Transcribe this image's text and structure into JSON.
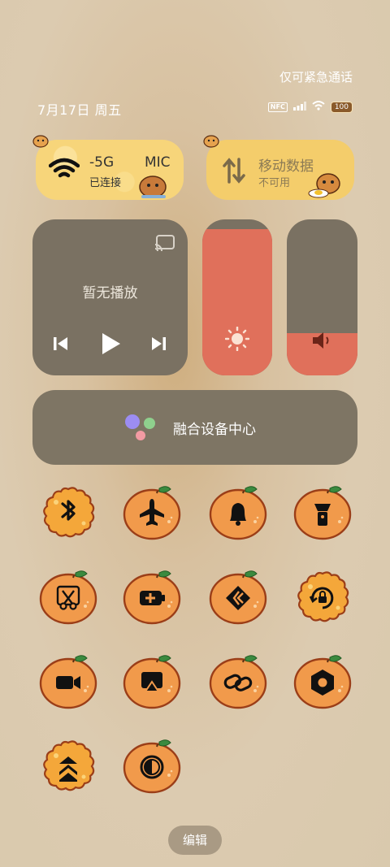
{
  "status_bar": {
    "emergency_text": "仅可紧急通话",
    "date_text": "7月17日 周五",
    "nfc_label": "NFC",
    "battery_level": "100"
  },
  "top_tiles": {
    "wifi": {
      "name": "-5G",
      "extra": "MIC",
      "status": "已连接"
    },
    "mobile_data": {
      "name": "移动数据",
      "status": "不可用"
    }
  },
  "media": {
    "status_text": "暂无播放"
  },
  "sliders": {
    "brightness_level": 0.94,
    "volume_level": 0.27
  },
  "fusion": {
    "label": "融合设备中心"
  },
  "toggles": [
    {
      "name": "bluetooth",
      "icon": "bluetooth-icon",
      "active": true
    },
    {
      "name": "airplane",
      "icon": "airplane-icon",
      "active": false
    },
    {
      "name": "ring",
      "icon": "bell-icon",
      "active": false
    },
    {
      "name": "flashlight",
      "icon": "flashlight-icon",
      "active": false
    },
    {
      "name": "screenshot",
      "icon": "scissors-icon",
      "active": false
    },
    {
      "name": "battery-saver",
      "icon": "battery-plus-icon",
      "active": false
    },
    {
      "name": "nfc",
      "icon": "nfc-icon",
      "active": false
    },
    {
      "name": "rotation-lock",
      "icon": "rotation-lock-icon",
      "active": true
    },
    {
      "name": "screen-record",
      "icon": "video-camera-icon",
      "active": false
    },
    {
      "name": "screen-cast",
      "icon": "cast-icon",
      "active": false
    },
    {
      "name": "link",
      "icon": "link-icon",
      "active": false
    },
    {
      "name": "settings",
      "icon": "hexagon-nut-icon",
      "active": false
    },
    {
      "name": "performance",
      "icon": "double-chevron-up-icon",
      "active": true
    },
    {
      "name": "dark-mode",
      "icon": "dark-mode-icon",
      "active": false
    }
  ],
  "edit": {
    "label": "编辑"
  },
  "colors": {
    "orange": "#f19a4b",
    "orange_outline": "#9b3e18",
    "leaf": "#3b8a3f",
    "tile_dark": "#7a7162",
    "slider_fill": "#e0705b"
  }
}
